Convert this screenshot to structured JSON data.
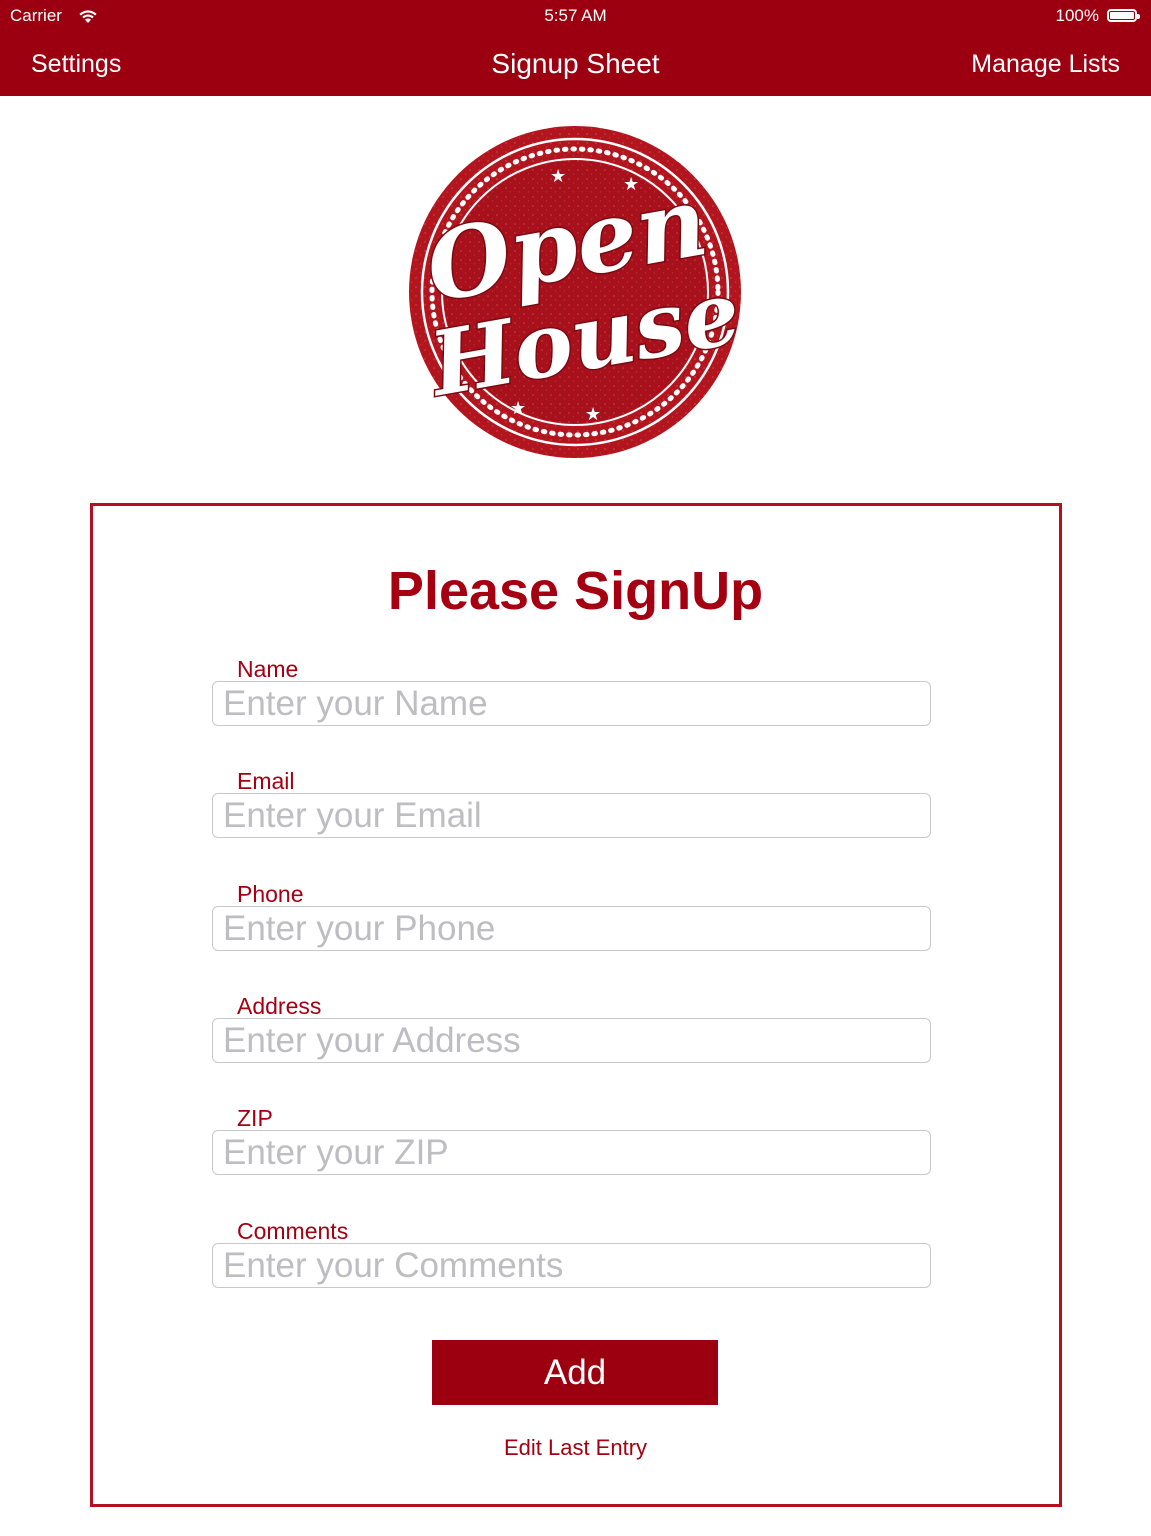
{
  "status_bar": {
    "carrier": "Carrier",
    "time": "5:57 AM",
    "battery": "100%"
  },
  "nav": {
    "left_label": "Settings",
    "title": "Signup Sheet",
    "right_label": "Manage Lists"
  },
  "logo": {
    "line1": "Open",
    "line2": "House"
  },
  "form": {
    "title": "Please SignUp",
    "fields": [
      {
        "label": "Name",
        "placeholder": "Enter your Name",
        "value": ""
      },
      {
        "label": "Email",
        "placeholder": "Enter your Email",
        "value": ""
      },
      {
        "label": "Phone",
        "placeholder": "Enter your Phone",
        "value": ""
      },
      {
        "label": "Address",
        "placeholder": "Enter your Address",
        "value": ""
      },
      {
        "label": "ZIP",
        "placeholder": "Enter your ZIP",
        "value": ""
      },
      {
        "label": "Comments",
        "placeholder": "Enter your Comments",
        "value": ""
      }
    ],
    "add_label": "Add",
    "edit_label": "Edit Last Entry"
  },
  "colors": {
    "brand": "#9c0010",
    "label": "#a50012",
    "placeholder": "#bdbdc2"
  },
  "icons": {
    "wifi": "wifi-icon",
    "battery": "battery-icon",
    "logo": "open-house-stamp-logo"
  }
}
